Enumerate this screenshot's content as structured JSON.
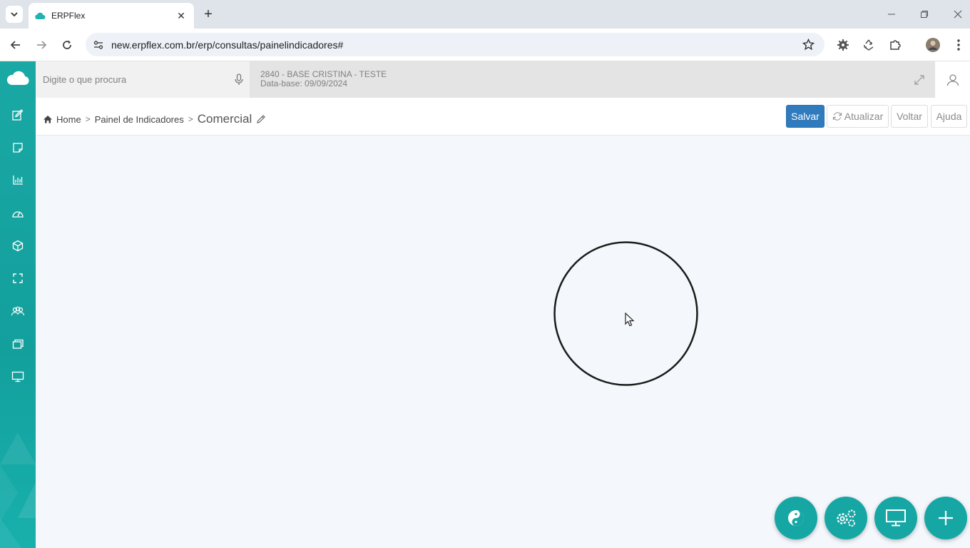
{
  "browser": {
    "tab_title": "ERPFlex",
    "tab_close": "✕",
    "new_tab": "+",
    "url": "new.erpflex.com.br/erp/consultas/painelindicadores#"
  },
  "header": {
    "search_placeholder": "Digite o que procura",
    "company_name": "2840 - BASE CRISTINA - TESTE",
    "data_base": "Data-base: 09/09/2024"
  },
  "breadcrumb": {
    "home": "Home",
    "panel": "Painel de Indicadores",
    "current": "Comercial",
    "separator": ">"
  },
  "actions": {
    "save": "Salvar",
    "refresh": "Atualizar",
    "back": "Voltar",
    "help": "Ajuda"
  },
  "sidebar": {
    "icons": [
      "edit-icon",
      "note-icon",
      "bar-chart-icon",
      "dashboard-icon",
      "box-icon",
      "fullscreen-icon",
      "users-icon",
      "layers-icon",
      "monitor-icon"
    ]
  },
  "fabs": [
    "yin-yang-icon",
    "gears-icon",
    "monitor-icon",
    "plus-icon"
  ],
  "colors": {
    "accent": "#16a7a5",
    "primary_button": "#2f7bbd"
  }
}
